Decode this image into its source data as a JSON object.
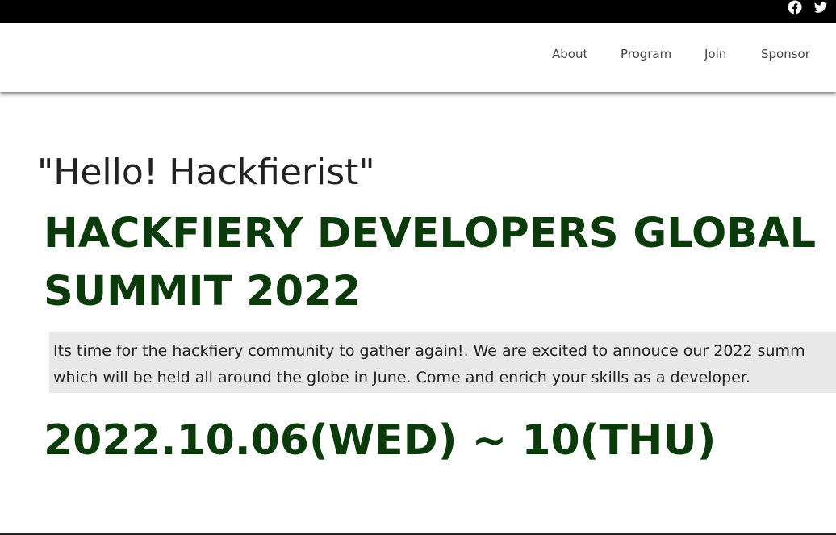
{
  "social": {
    "facebook_icon": "facebook-icon",
    "twitter_icon": "twitter-icon"
  },
  "nav": {
    "items": [
      {
        "label": "About"
      },
      {
        "label": "Program"
      },
      {
        "label": "Join"
      },
      {
        "label": "Sponsor"
      }
    ]
  },
  "hero": {
    "greeting": "\"Hello! Hackfierist\"",
    "headline_line1": "HACKFIERY DEVELOPERS GLOBAL",
    "headline_line2": "SUMMIT 2022",
    "intro_line1": "Its time for the hackfiery community to gather again!. We are excited to annouce our 2022 summ",
    "intro_line2": "which will be held all around the globe in June. Come and enrich your skills as a developer.",
    "dates": "2022.10.06(WED) ~ 10(THU)"
  },
  "colors": {
    "topbar": "#000000",
    "headline": "#0b3b0b",
    "intro_bg": "#e9e8e8"
  }
}
